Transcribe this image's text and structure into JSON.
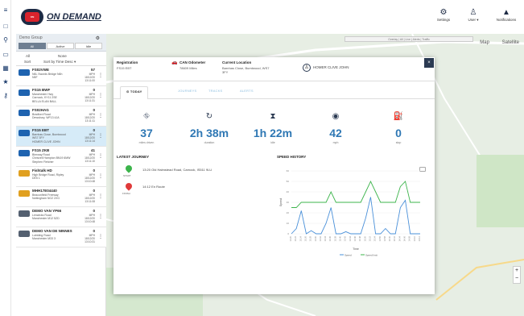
{
  "app": {
    "logo_text": "ON DEMAND",
    "logo_badge": "ON DEMAND"
  },
  "header": {
    "buttons": [
      {
        "label": "Settings",
        "icon": "settings-icon"
      },
      {
        "label": "User ▾",
        "icon": "user-icon"
      },
      {
        "label": "Notifications",
        "icon": "bell-icon"
      }
    ]
  },
  "rail": {
    "icons": [
      "menu-icon",
      "layers-icon",
      "location-icon",
      "video-icon",
      "grid-icon",
      "star-icon",
      "key-icon"
    ]
  },
  "vehicle_panel": {
    "group_label": "Demo Group",
    "segments": [
      "All",
      "Active",
      "Idle"
    ],
    "sort_left_top": "All",
    "sort_left_bottom": "Sort",
    "sort_right_top": "None",
    "sort_right_bottom": "Sort by Time Desc ▾",
    "vehicles": [
      {
        "name": "FS02VWE",
        "addr": "N6L Swords Bridge N6h\nN5F",
        "speed": "57",
        "time": "MPH\n18/12/20\n13:11:00",
        "icon": "b",
        "selected": false
      },
      {
        "name": "FS15 BWF",
        "addr": "Manchester Hwy\nCarnock, KY11 2SE\nBELLA ELAN BALL",
        "speed": "0",
        "time": "MPH\n18/12/20\n13:11:31",
        "icon": "b",
        "selected": false
      },
      {
        "name": "FS02HAG",
        "addr": "Bradford Road\nDewsbury, WF13 4JA",
        "speed": "0",
        "time": "MPH\n18/12/20\n13:11:11",
        "icon": "b",
        "selected": false
      },
      {
        "name": "FS15 EBT",
        "addr": "Barnhas Close, Burntwood\nWS7 3FY\nHOMER CLIVE JOHN",
        "speed": "0",
        "time": "MPH\n18/12/20\n13:11:14",
        "icon": "b",
        "selected": true
      },
      {
        "name": "FS15 ZKB",
        "addr": "Birnway Road\nChrisvell Hampton BN19 6MW\nStephen Fletcher",
        "speed": "41",
        "time": "MPH\n18/12/20\n13:11:10",
        "icon": "b",
        "selected": false
      },
      {
        "name": "Fishtalk HD",
        "addr": "High Bridge Road, Ripley\nDE5 1",
        "speed": "0",
        "time": "MPH\n18/12/20\n13:10:48",
        "icon": "y",
        "selected": false
      },
      {
        "name": "MHH17E04440",
        "addr": "Beaconfield Freeway\nNottingham NG2 2XG",
        "speed": "0",
        "time": "MPH\n18/12/20\n13:11:08",
        "icon": "y",
        "selected": false
      },
      {
        "name": "DEMO VAN YP66",
        "addr": "Lenwicks Road\nManchester M12 5ZD",
        "speed": "0",
        "time": "MPH\n18/12/20\n13:10:48",
        "icon": "g",
        "selected": false
      },
      {
        "name": "DEMO VAN DE NINNES",
        "addr": "Lubiding Road\nManchester M33 3",
        "speed": "0",
        "time": "MPH\n18/12/20\n13:10:31",
        "icon": "g",
        "selected": false
      }
    ]
  },
  "map": {
    "tabs": [
      "Map",
      "Satellite"
    ],
    "bar_text": "Overlay | All | Live | Alerts | Traffic"
  },
  "modal": {
    "registration_label": "Registration",
    "registration_value": "FS15 EBT",
    "odometer_label": "CAN Odometer",
    "odometer_value": "78609 Miles",
    "location_label": "Current Location",
    "location_value": "Barnhas Close, Burntwood, WS7\n3FY",
    "driver": "HOMER CLIVE JOHN",
    "close": "×",
    "tabs": [
      "TODAY",
      "JOURNEYS",
      "TRACKS",
      "ALERTS"
    ],
    "stats": [
      {
        "icon": "road-icon",
        "glyph": "⛗",
        "value": "37",
        "label": "miles driven"
      },
      {
        "icon": "duration-icon",
        "glyph": "↻",
        "value": "2h 38m",
        "label": "duration"
      },
      {
        "icon": "idle-hourglass-icon",
        "glyph": "⧗",
        "value": "1h 22m",
        "label": "idle"
      },
      {
        "icon": "high-speed-icon",
        "glyph": "◉",
        "value": "42",
        "label": "mph"
      },
      {
        "icon": "fuel-icon",
        "glyph": "⛽",
        "value": "0",
        "label": "stop"
      }
    ],
    "latest_journey_title": "LATEST JOURNEY",
    "journey_start_label": "START",
    "journey_start_text": "13:20 Old Halmstead Road, Carnock, IS511 9LU",
    "journey_finish_label": "FINISH",
    "journey_finish_text": "14:12 En Route",
    "speed_history_title": "SPEED HISTORY",
    "legend_speed": "Speed",
    "legend_limit": "Speed limit"
  },
  "chart_data": {
    "type": "line",
    "title": "SPEED HISTORY",
    "xlabel": "Time",
    "ylabel": "Speed",
    "ylim": [
      0,
      60
    ],
    "x": [
      "13:20",
      "13:22",
      "13:24",
      "13:26",
      "13:28",
      "13:30",
      "13:32",
      "13:34",
      "13:36",
      "13:38",
      "13:40",
      "13:42",
      "13:44",
      "13:46",
      "13:48",
      "13:50",
      "13:52",
      "13:54",
      "13:56",
      "13:58",
      "14:00",
      "14:02",
      "14:04",
      "14:06",
      "14:08",
      "14:10",
      "14:12"
    ],
    "series": [
      {
        "name": "Speed",
        "color": "#4a90d9",
        "values": [
          0,
          5,
          22,
          0,
          3,
          0,
          0,
          10,
          25,
          0,
          0,
          2,
          0,
          0,
          0,
          15,
          35,
          0,
          0,
          5,
          0,
          0,
          25,
          32,
          0,
          0,
          0
        ]
      },
      {
        "name": "Speed limit",
        "color": "#3cb44b",
        "values": [
          25,
          25,
          30,
          30,
          30,
          30,
          30,
          30,
          40,
          30,
          30,
          30,
          30,
          30,
          30,
          40,
          50,
          40,
          30,
          30,
          30,
          30,
          45,
          50,
          30,
          30,
          30
        ]
      }
    ]
  }
}
